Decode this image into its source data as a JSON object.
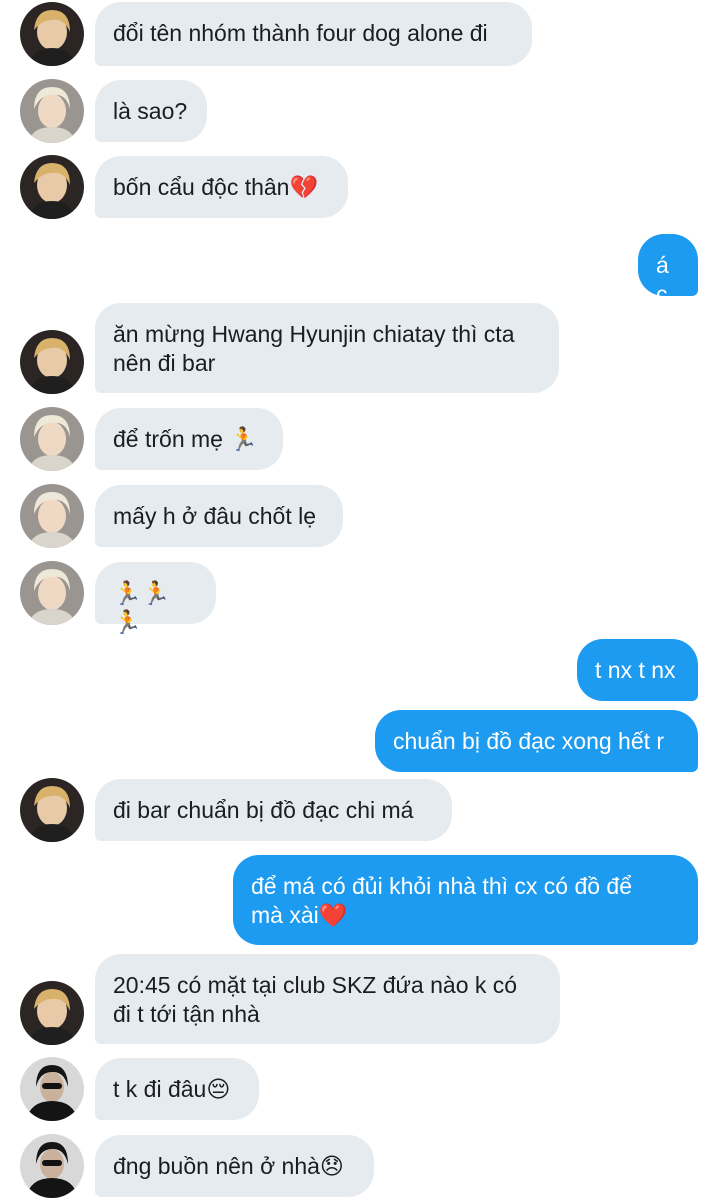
{
  "chat": {
    "messages": [
      {
        "side": "in",
        "avatar": "avatar-blonde",
        "text": "đổi tên nhóm thành four dog alone đi"
      },
      {
        "side": "in",
        "avatar": "avatar-platinum",
        "text": "là sao?"
      },
      {
        "side": "in",
        "avatar": "avatar-blonde",
        "text": "bốn cẩu độc thân💔"
      },
      {
        "side": "out",
        "text": "ác"
      },
      {
        "side": "in",
        "avatar": "avatar-blonde",
        "text": "ăn mừng Hwang Hyunjin chiatay thì cta\nnên đi bar"
      },
      {
        "side": "in",
        "avatar": "avatar-platinum",
        "text": "để trốn mẹ 🏃"
      },
      {
        "side": "in",
        "avatar": "avatar-platinum",
        "text": "mấy h ở đâu chốt lẹ"
      },
      {
        "side": "in",
        "avatar": "avatar-platinum",
        "text": "🏃🏃🏃"
      },
      {
        "side": "out",
        "text": "t nx t nx"
      },
      {
        "side": "out",
        "text": "chuẩn bị đồ đạc xong hết r"
      },
      {
        "side": "in",
        "avatar": "avatar-blonde",
        "text": "đi bar chuẩn bị đồ đạc chi má"
      },
      {
        "side": "out",
        "text": "để má có đủi khỏi nhà thì cx có đồ để\nmà xài❤️"
      },
      {
        "side": "in",
        "avatar": "avatar-blonde",
        "text": "20:45 có mặt tại club SKZ đứa nào k có\nđi t tới tận nhà"
      },
      {
        "side": "in",
        "avatar": "avatar-dark",
        "text": "t k đi đâu😔"
      },
      {
        "side": "in",
        "avatar": "avatar-dark",
        "text": "đng buồn nên ở nhà😞"
      }
    ]
  },
  "colors": {
    "incoming_bubble": "#e6ebef",
    "outgoing_bubble": "#1d9bf0",
    "incoming_text": "#1a1d21",
    "outgoing_text": "#ffffff"
  }
}
